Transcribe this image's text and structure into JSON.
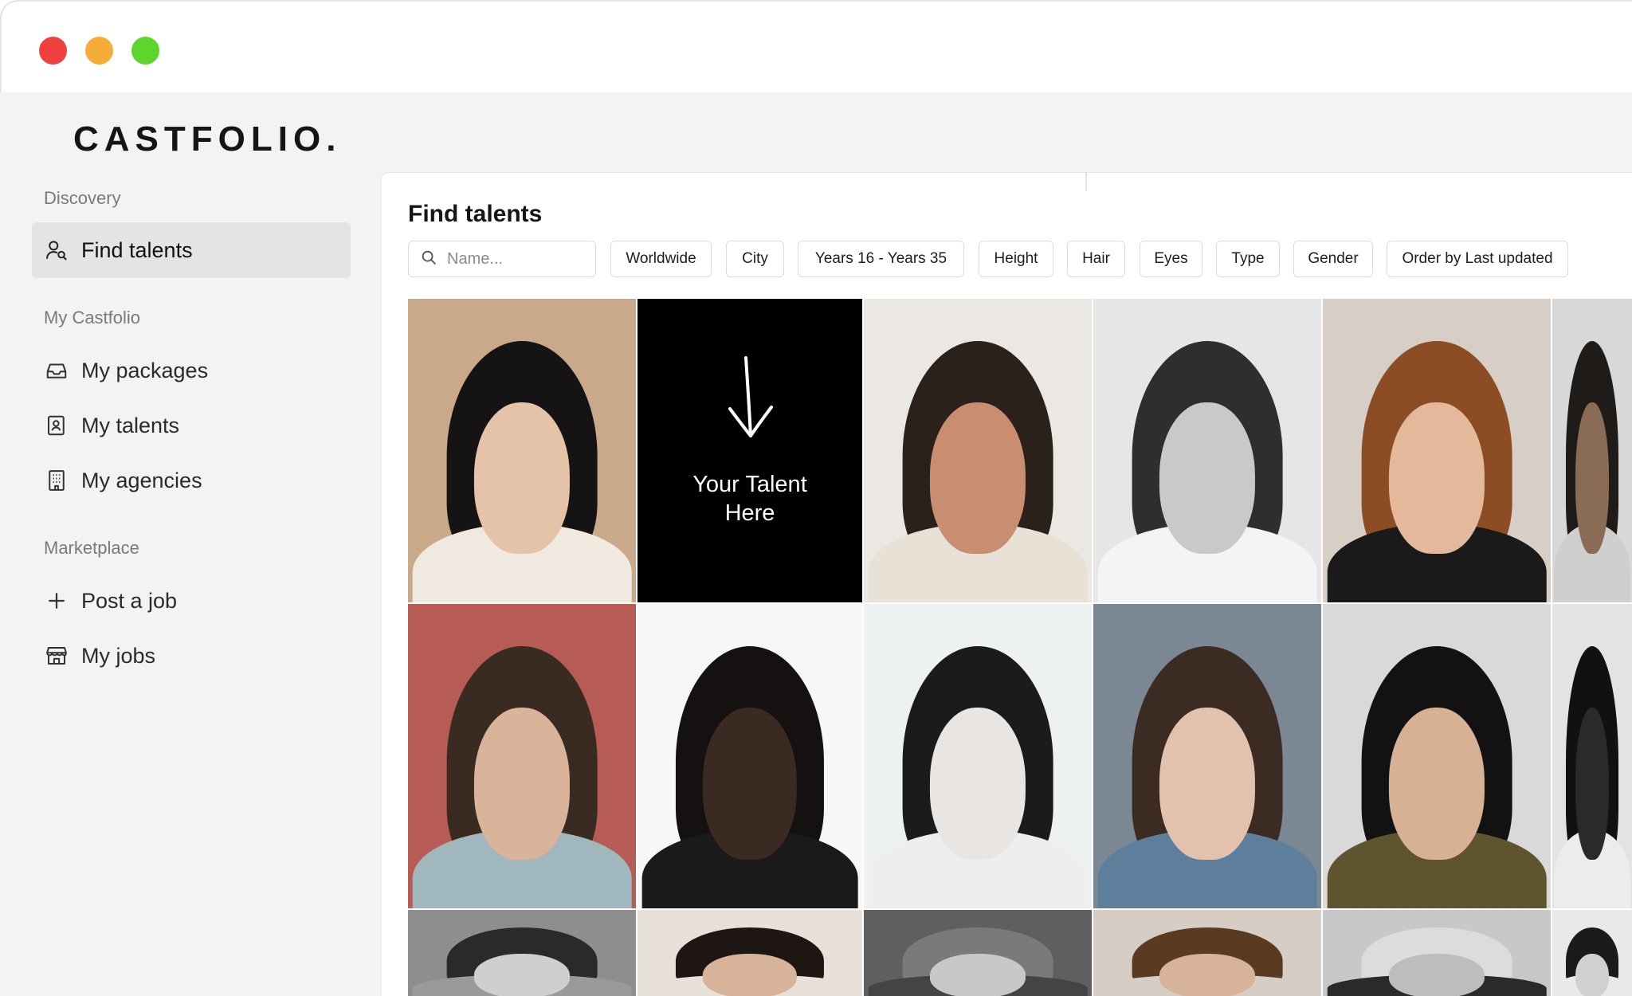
{
  "window": {
    "controls": {
      "close_color": "#f04040",
      "minimize_color": "#f5ad38",
      "maximize_color": "#5ed42c"
    }
  },
  "brand": {
    "logo": "CASTFOLIO."
  },
  "sidebar": {
    "sections": [
      {
        "label": "Discovery"
      },
      {
        "label": "My Castfolio"
      },
      {
        "label": "Marketplace"
      }
    ],
    "items": [
      {
        "label": "Find talents",
        "icon": "user-search-icon",
        "active": true
      },
      {
        "label": "My packages",
        "icon": "inbox-icon"
      },
      {
        "label": "My talents",
        "icon": "contact-book-icon"
      },
      {
        "label": "My agencies",
        "icon": "building-icon"
      },
      {
        "label": "Post a job",
        "icon": "plus-icon"
      },
      {
        "label": "My jobs",
        "icon": "store-icon"
      }
    ]
  },
  "main": {
    "title": "Find talents",
    "search": {
      "placeholder": "Name...",
      "value": ""
    },
    "filters": [
      {
        "label": "Worldwide"
      },
      {
        "label": "City"
      },
      {
        "label": "Years 16 - Years 35"
      },
      {
        "label": "Height"
      },
      {
        "label": "Hair"
      },
      {
        "label": "Eyes"
      },
      {
        "label": "Type"
      },
      {
        "label": "Gender"
      },
      {
        "label": "Order by Last updated"
      }
    ],
    "promo_tile": {
      "line1": "Your Talent",
      "line2": "Here",
      "icon": "arrow-down-icon"
    },
    "talent_tiles": [
      {
        "name": "talent-photo",
        "bg": "#c9a98a",
        "skin": "#e5c3a8",
        "hair": "#151313",
        "top": "#efe9df"
      },
      {
        "name": "talent-photo",
        "bg": "#ebe8e3",
        "skin": "#c98d72",
        "hair": "#2a211b",
        "top": "#e8e2d6"
      },
      {
        "name": "talent-photo",
        "bg": "#e6e6e6",
        "skin": "#c9c9c9",
        "hair": "#2e2e2e",
        "top": "#f4f4f4"
      },
      {
        "name": "talent-photo",
        "bg": "#d7cfc6",
        "skin": "#e3b89b",
        "hair": "#8d4d24",
        "top": "#1a1a1a"
      },
      {
        "name": "talent-photo",
        "bg": "#d8d8d8",
        "skin": "#8a6b55",
        "hair": "#1f1b18",
        "top": "#cfcfcf"
      },
      {
        "name": "talent-photo",
        "bg": "#b75b55",
        "skin": "#d9b49b",
        "hair": "#3a2b22",
        "top": "#9fb7bd"
      },
      {
        "name": "talent-photo",
        "bg": "#f7f7f7",
        "skin": "#3a2a22",
        "hair": "#141110",
        "top": "#1a1a1a"
      },
      {
        "name": "talent-photo",
        "bg": "#eef1f1",
        "skin": "#e8e5e3",
        "hair": "#1b1b1b",
        "top": "#eeeeee"
      },
      {
        "name": "talent-photo",
        "bg": "#7b8793",
        "skin": "#e2c2ad",
        "hair": "#3b2b22",
        "top": "#5d7f9c"
      },
      {
        "name": "talent-photo",
        "bg": "#d9d9d9",
        "skin": "#d6b194",
        "hair": "#121212",
        "top": "#5f5430"
      },
      {
        "name": "talent-photo",
        "bg": "#e3e3e3",
        "skin": "#2a2a2a",
        "hair": "#111111",
        "top": "#ececec"
      },
      {
        "name": "talent-photo",
        "bg": "#8e8e8e",
        "skin": "#cfcfcf",
        "hair": "#2a2a2a",
        "top": "#9a9a9a"
      },
      {
        "name": "talent-photo",
        "bg": "#e8e1d9",
        "skin": "#d7b39a",
        "hair": "#1e1612",
        "top": "#e8e1d9"
      },
      {
        "name": "talent-photo",
        "bg": "#5f5f5f",
        "skin": "#c8c8c8",
        "hair": "#7a7a7a",
        "top": "#444444"
      },
      {
        "name": "talent-photo",
        "bg": "#d6cdc4",
        "skin": "#d7b39a",
        "hair": "#5b3a22",
        "top": "#d6cdc4"
      },
      {
        "name": "talent-photo",
        "bg": "#c8c8c8",
        "skin": "#bdbdbd",
        "hair": "#dcdcdc",
        "top": "#2a2a2a"
      },
      {
        "name": "talent-photo",
        "bg": "#e9e9e9",
        "skin": "#d0d0d0",
        "hair": "#1a1a1a",
        "top": "#e9e9e9"
      }
    ]
  }
}
